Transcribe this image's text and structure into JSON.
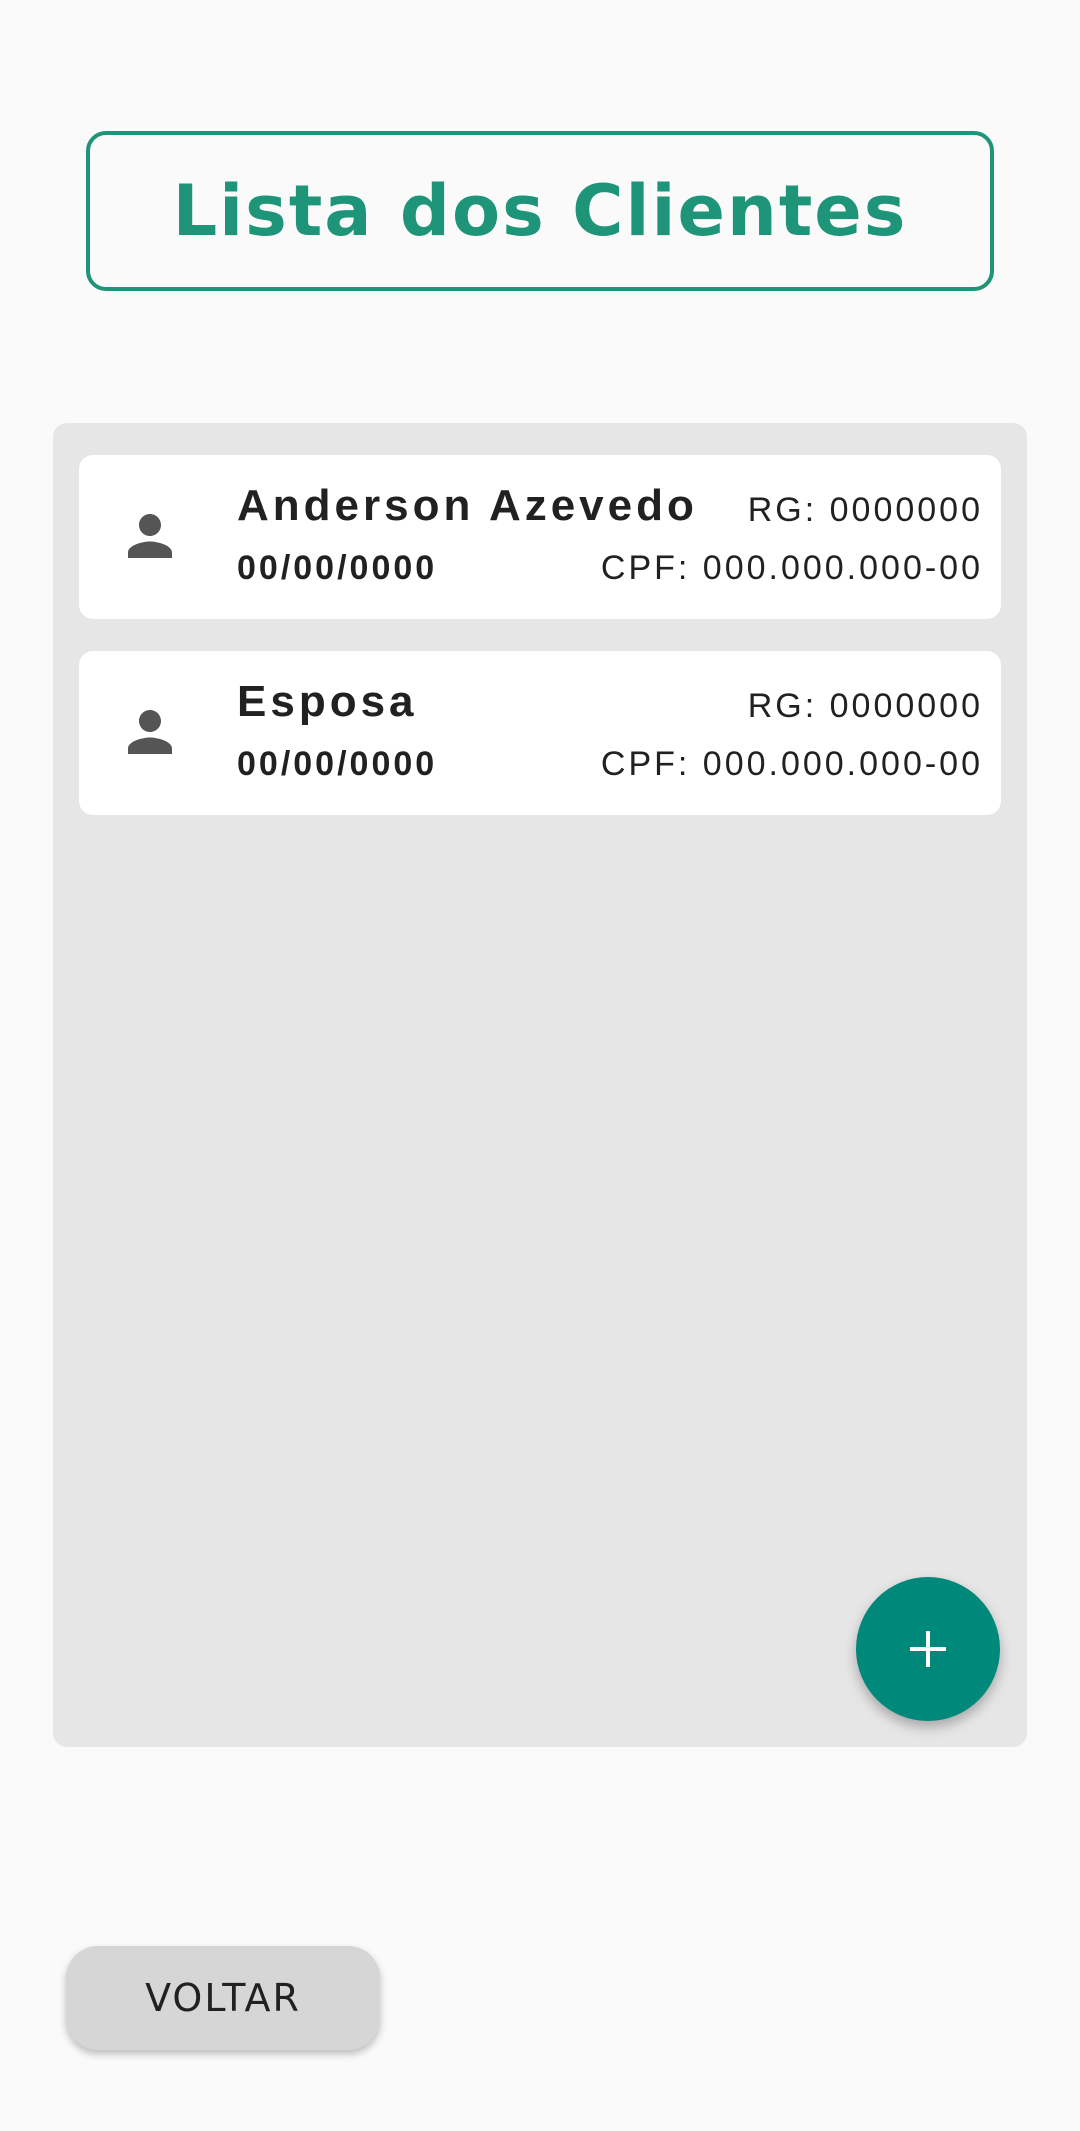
{
  "header": {
    "title": "Lista dos Clientes"
  },
  "clients": [
    {
      "name": "Anderson Azevedo",
      "date": "00/00/0000",
      "rg": "RG: 0000000",
      "cpf": "CPF: 000.000.000-00",
      "icon": "person-icon"
    },
    {
      "name": "Esposa",
      "date": "00/00/0000",
      "rg": "RG: 0000000",
      "cpf": "CPF: 000.000.000-00",
      "icon": "person-icon"
    }
  ],
  "fab": {
    "label": "+",
    "icon": "plus-icon"
  },
  "footer": {
    "back_label": "VOLTAR"
  },
  "colors": {
    "accent": "#1e9478",
    "fab": "#00897b",
    "panel": "#e6e6e6",
    "background": "#fafafa"
  }
}
